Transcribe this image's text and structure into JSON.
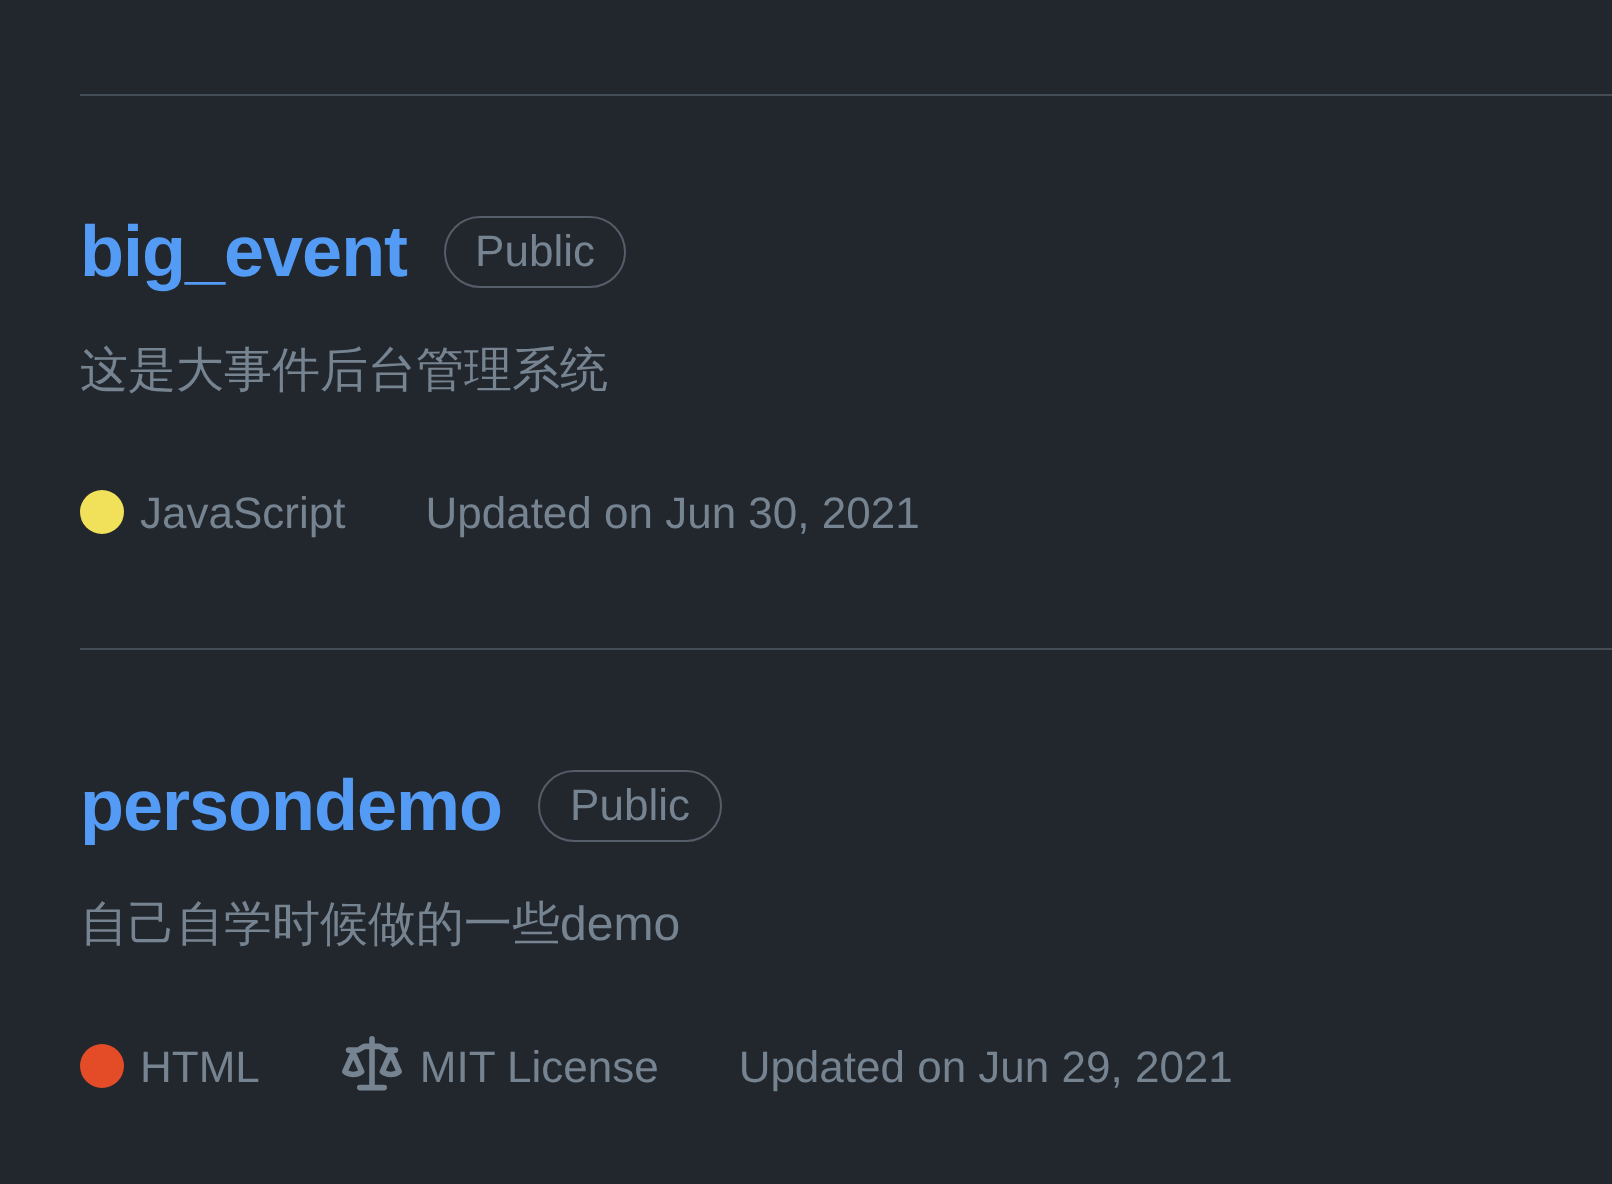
{
  "repositories": [
    {
      "name": "big_event",
      "visibility": "Public",
      "description": "这是大事件后台管理系统",
      "language": "JavaScript",
      "color": "#f1e05a",
      "updated": "Updated on Jun 30, 2021"
    },
    {
      "name": "persondemo",
      "visibility": "Public",
      "description": "自己自学时候做的一些demo",
      "language": "HTML",
      "color": "#e34c26",
      "license": "MIT License",
      "updated": "Updated on Jun 29, 2021"
    }
  ]
}
